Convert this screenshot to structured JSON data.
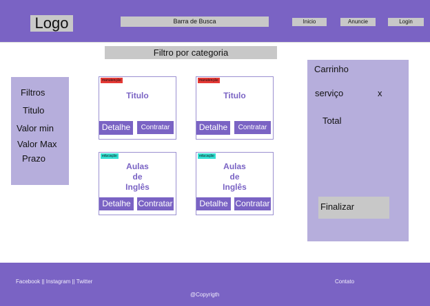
{
  "header": {
    "logo": "Logo",
    "search_label": "Barra de Busca",
    "nav": {
      "inicio": "Inicio",
      "anuncie": "Anuncie",
      "login": "Login"
    }
  },
  "category_filter": "Filtro por categoria",
  "filters": {
    "title": "Filtros",
    "titulo": "Titulo",
    "valor_min": "Valor min",
    "valor_max": "Valor Max",
    "prazo": "Prazo"
  },
  "cards": [
    {
      "tag": "manutenção",
      "title": "Titulo",
      "detail": "Detalhe",
      "hire": "Contratar"
    },
    {
      "tag": "manutenção",
      "title": "Titulo",
      "detail": "Detalhe",
      "hire": "Contratar"
    },
    {
      "tag": "educação",
      "title_lines": [
        "Aulas",
        "de",
        "Inglês"
      ],
      "detail": "Detalhe",
      "hire": "Contratar"
    },
    {
      "tag": "educação",
      "title_lines": [
        "Aulas",
        "de",
        "Inglês"
      ],
      "detail": "Detalhe",
      "hire": "Contratar"
    }
  ],
  "cart": {
    "title": "Carrinho",
    "item_label": "serviço",
    "remove": "x",
    "total_label": "Total",
    "finalize": "Finalizar"
  },
  "footer": {
    "social": "Facebook  || Instagram || Twitter",
    "contact": "Contato",
    "copyright": "@Copyrigth"
  },
  "colors": {
    "primary": "#7a63c4",
    "panel": "#b6aedc",
    "placeholder_gray": "#c8c8c8",
    "tag_maintenance": "#e53935",
    "tag_education": "#33e0d3"
  }
}
